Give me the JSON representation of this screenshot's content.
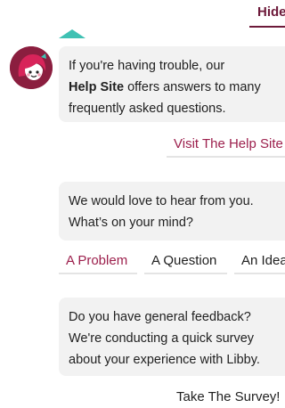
{
  "header": {
    "hide_label": "Hide"
  },
  "colors": {
    "accent": "#9c1f4c",
    "dark_accent": "#6d1a3a",
    "teal": "#3fc1b3",
    "bubble_bg": "#f2f2f2"
  },
  "messages": [
    {
      "line1": "If you're having trouble, our",
      "bold": "Help Site",
      "line2_rest": " offers answers to many",
      "line3": "frequently asked questions."
    },
    {
      "line1": "We would love to hear from you.",
      "line2": "What’s on your mind?"
    },
    {
      "line1": "Do you have general feedback?",
      "line2": "We're conducting a quick survey",
      "line3": "about your experience with Libby."
    }
  ],
  "actions": {
    "help_site": "Visit The Help Site",
    "choices": [
      "A Problem",
      "A Question",
      "An Idea"
    ],
    "survey": "Take The Survey!"
  }
}
